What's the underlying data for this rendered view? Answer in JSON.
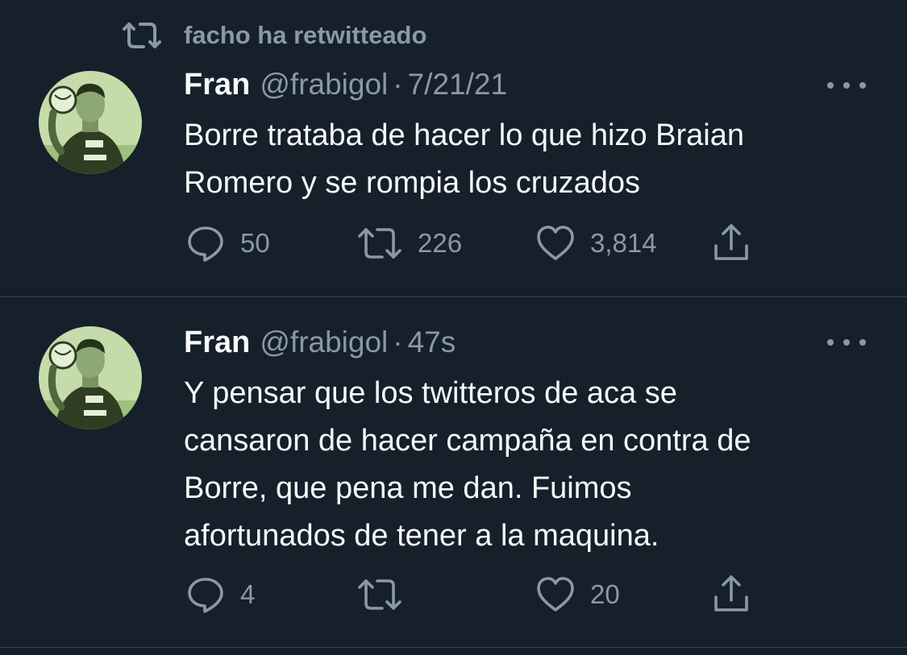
{
  "theme": {
    "background": "#15202b",
    "text_primary": "#f7f9f9",
    "text_secondary": "#8b98a5",
    "divider": "#38444d",
    "avatar_tint": "#b9d39a"
  },
  "tweets": [
    {
      "retweet_context": {
        "icon": "retweet-icon",
        "label": "facho ha retwitteado"
      },
      "author": {
        "name": "Fran",
        "handle": "@frabigol"
      },
      "separator": "·",
      "timestamp": "7/21/21",
      "text": "Borre trataba de hacer lo que hizo Braian\nRomero y se rompia los cruzados",
      "actions": {
        "reply": {
          "icon": "reply-icon",
          "count": "50"
        },
        "retweet": {
          "icon": "retweet-icon",
          "count": "226"
        },
        "like": {
          "icon": "heart-icon",
          "count": "3,814"
        },
        "share": {
          "icon": "share-icon"
        }
      }
    },
    {
      "author": {
        "name": "Fran",
        "handle": "@frabigol"
      },
      "separator": "·",
      "timestamp": "47s",
      "text": "Y pensar que los twitteros de aca se\ncansaron de hacer campaña en contra de\nBorre, que pena me dan. Fuimos\nafortunados de tener a la maquina.",
      "actions": {
        "reply": {
          "icon": "reply-icon",
          "count": "4"
        },
        "retweet": {
          "icon": "retweet-icon",
          "count": ""
        },
        "like": {
          "icon": "heart-icon",
          "count": "20"
        },
        "share": {
          "icon": "share-icon"
        }
      }
    }
  ]
}
